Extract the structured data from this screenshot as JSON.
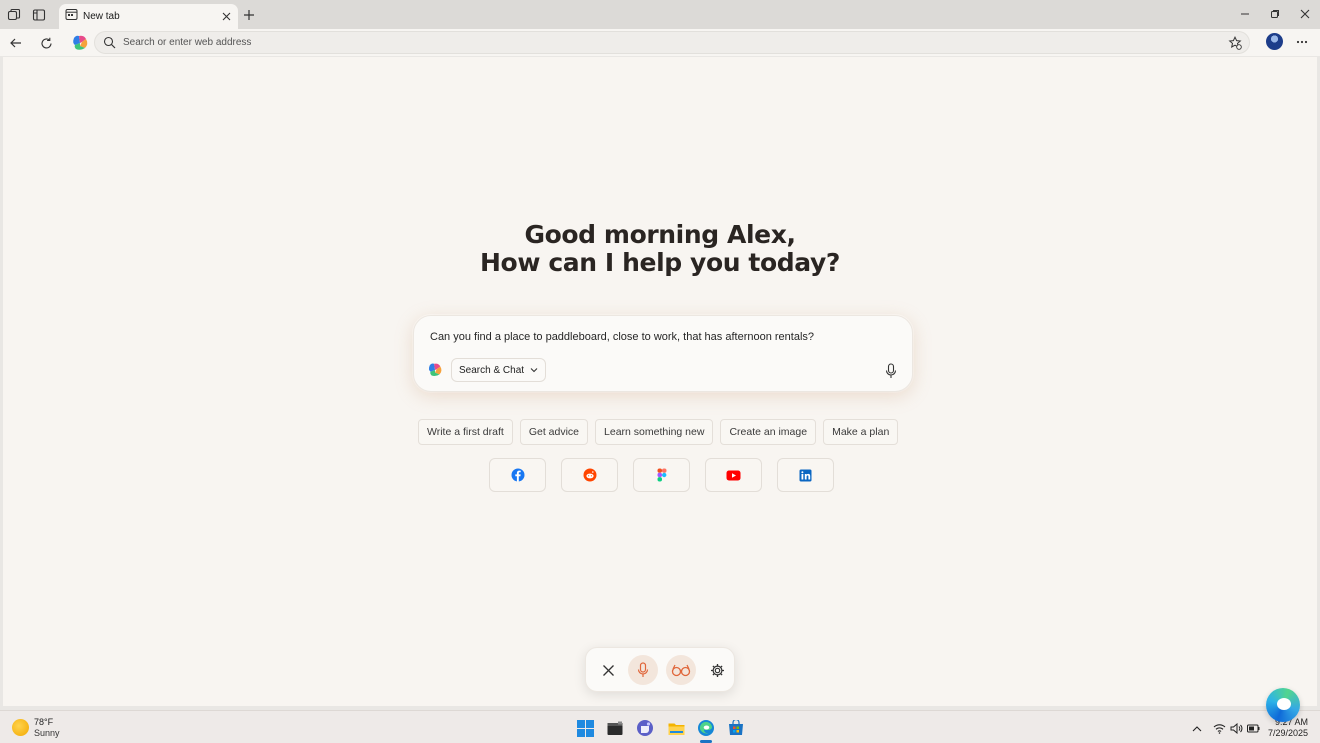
{
  "window": {
    "tab_title": "New tab",
    "controls": [
      "minimize",
      "restore",
      "close"
    ]
  },
  "toolbar": {
    "address_placeholder": "Search or enter web address"
  },
  "page": {
    "greeting_line1": "Good morning Alex,",
    "greeting_line2": "How can I help you today?",
    "chat": {
      "prompt": "Can you find a place to paddleboard, close to work, that has afternoon rentals?",
      "mode": "Search & Chat"
    },
    "suggestions": [
      "Write a first draft",
      "Get advice",
      "Learn something new",
      "Create an image",
      "Make a plan"
    ],
    "shortcuts": [
      {
        "name": "Facebook",
        "icon": "facebook-icon",
        "color": "#1877f2"
      },
      {
        "name": "Reddit",
        "icon": "reddit-icon",
        "color": "#ff4500"
      },
      {
        "name": "Figma",
        "icon": "figma-icon",
        "color": "#f24e1e"
      },
      {
        "name": "YouTube",
        "icon": "youtube-icon",
        "color": "#ff0000"
      },
      {
        "name": "LinkedIn",
        "icon": "linkedin-icon",
        "color": "#0a66c2"
      }
    ],
    "voice_controls": [
      "close-icon",
      "microphone-icon",
      "glasses-icon",
      "gear-icon"
    ]
  },
  "taskbar": {
    "weather_temp": "78°F",
    "weather_desc": "Sunny",
    "apps": [
      "windows-start-icon",
      "terminal-icon",
      "teams-icon",
      "file-explorer-icon",
      "edge-icon",
      "store-icon"
    ],
    "time": "9:27 AM",
    "date": "7/29/2025"
  },
  "colors": {
    "accent_orange": "#e0663a",
    "page_background": "#f8f5f1",
    "taskbar_active": "#1a73c4"
  }
}
